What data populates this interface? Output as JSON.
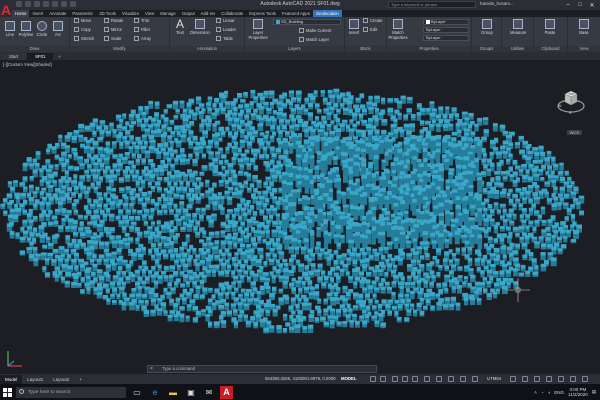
{
  "titlebar": {
    "app_logo": "A",
    "title": "Autodesk AutoCAD 2021   SF01.dwg",
    "search_placeholder": "Type a keyword or phrase",
    "user": "hareda_hosam..."
  },
  "ribbon_tabs": [
    "Home",
    "Insert",
    "Annotate",
    "Parametric",
    "3D Tools",
    "Visualize",
    "View",
    "Manage",
    "Output",
    "Add-ins",
    "Collaborate",
    "Express Tools",
    "Featured Apps",
    "Geolocation"
  ],
  "ribbon": {
    "draw": {
      "title": "Draw",
      "tools": [
        "Line",
        "Polyline",
        "Circle",
        "Arc"
      ]
    },
    "modify": {
      "title": "Modify",
      "tools": [
        "Move",
        "Rotate",
        "Trim",
        "Copy",
        "Mirror",
        "Fillet",
        "Stretch",
        "Scale",
        "Array"
      ]
    },
    "annotation": {
      "title": "Annotation",
      "tools": [
        "Text",
        "Dimension",
        "Linear",
        "Leader",
        "Table"
      ]
    },
    "layers": {
      "title": "Layers",
      "big": "Layer Properties",
      "dropdown": "SD_Building",
      "tools": [
        "Make Current",
        "Match Layer"
      ]
    },
    "block": {
      "title": "Block",
      "tools": [
        "Insert",
        "Create",
        "Edit",
        "Edit Attributes"
      ]
    },
    "properties": {
      "title": "Properties",
      "big": "Match Properties",
      "dropdowns": [
        "ByLayer",
        "ByLayer",
        "ByLayer"
      ]
    },
    "groups": {
      "title": "Groups",
      "tool": "Group"
    },
    "utilities": {
      "title": "Utilities",
      "tool": "Measure"
    },
    "clipboard": {
      "title": "Clipboard",
      "tool": "Paste"
    },
    "view": {
      "title": "View",
      "tool": "Base"
    }
  },
  "doc_tabs": [
    "Start",
    "SF01"
  ],
  "viewport": {
    "label": "[-][Custom View][Shaded]",
    "cube_label": "TOP",
    "compass": {
      "n": "N",
      "s": "S",
      "w": "W",
      "e": "E"
    },
    "wcs": "WCS",
    "building_color": "#3aa6c8"
  },
  "cmdline": {
    "placeholder": "Type a command",
    "close": "×"
  },
  "statusbar": {
    "layout_tabs": [
      "Model",
      "Layout1",
      "Layout2",
      "+"
    ],
    "coords": "554350.3286, 4183091.6978, 0.0000",
    "mode": "MODEL",
    "scale": "UTM84",
    "zoom": "1:1 / 100%"
  },
  "taskbar": {
    "search_placeholder": "Type here to search",
    "lang": "ENG",
    "time": "3:00 PM",
    "date": "11/2/2020"
  }
}
